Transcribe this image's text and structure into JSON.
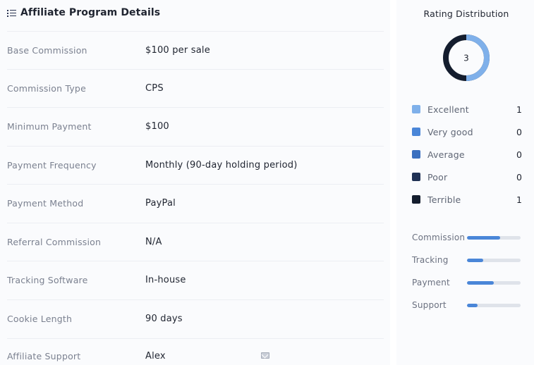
{
  "details": {
    "title": "Affiliate Program Details",
    "rows": [
      {
        "label": "Base Commission",
        "value": "$100 per sale"
      },
      {
        "label": "Commission Type",
        "value": "CPS"
      },
      {
        "label": "Minimum Payment",
        "value": "$100"
      },
      {
        "label": "Payment Frequency",
        "value": "Monthly (90-day holding period)"
      },
      {
        "label": "Payment Method",
        "value": "PayPal"
      },
      {
        "label": "Referral Commission",
        "value": "N/A"
      },
      {
        "label": "Tracking Software",
        "value": "In-house"
      },
      {
        "label": "Cookie Length",
        "value": "90 days"
      },
      {
        "label": "Affiliate Support",
        "value": "Alex"
      }
    ]
  },
  "rating": {
    "title": "Rating Distribution",
    "center_value": "3",
    "legend": [
      {
        "name": "Excellent",
        "count": "1",
        "color": "#7fb0ea"
      },
      {
        "name": "Very good",
        "count": "0",
        "color": "#4a86d8"
      },
      {
        "name": "Average",
        "count": "0",
        "color": "#3a6fbf"
      },
      {
        "name": "Poor",
        "count": "0",
        "color": "#1f3154"
      },
      {
        "name": "Terrible",
        "count": "1",
        "color": "#141d2e"
      }
    ],
    "bars": [
      {
        "label": "Commission",
        "fraction": 0.62
      },
      {
        "label": "Tracking",
        "fraction": 0.3
      },
      {
        "label": "Payment",
        "fraction": 0.5
      },
      {
        "label": "Support",
        "fraction": 0.2
      }
    ]
  },
  "colors": {
    "accent": "#4a86d8",
    "donut_light": "#7fb0ea",
    "donut_dark": "#141d2e",
    "track": "#dfe3ea"
  }
}
